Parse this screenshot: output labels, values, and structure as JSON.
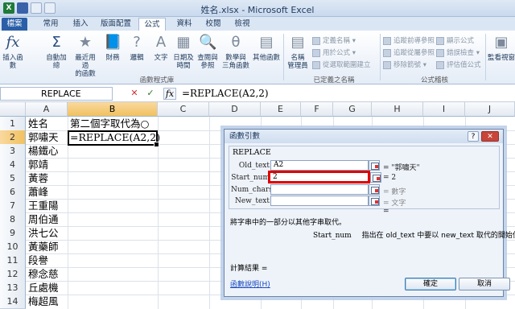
{
  "window": {
    "title": "姓名.xlsx - Microsoft Excel"
  },
  "tabs": [
    "檔案",
    "常用",
    "插入",
    "版面配置",
    "公式",
    "資料",
    "校閱",
    "檢視"
  ],
  "ribbon": {
    "buttons": [
      {
        "label1": "插入函數",
        "label2": "",
        "icon": "fx"
      },
      {
        "label1": "自動加總",
        "label2": "",
        "icon": "Σ"
      },
      {
        "label1": "最近用過",
        "label2": "的函數",
        "icon": "★"
      },
      {
        "label1": "財務",
        "label2": "",
        "icon": "📘"
      },
      {
        "label1": "邏輯",
        "label2": "",
        "icon": "?"
      },
      {
        "label1": "文字",
        "label2": "",
        "icon": "A"
      },
      {
        "label1": "日期及",
        "label2": "時間",
        "icon": "▦"
      },
      {
        "label1": "查閱與",
        "label2": "參照",
        "icon": "🔍"
      },
      {
        "label1": "數學與",
        "label2": "三角函數",
        "icon": "θ"
      },
      {
        "label1": "其他函數",
        "label2": "",
        "icon": "▤"
      },
      {
        "label1": "名稱",
        "label2": "管理員",
        "icon": "▤"
      },
      {
        "label1": "監看視窗",
        "label2": "",
        "icon": "▣"
      }
    ],
    "small": [
      "定義名稱 ▾",
      "用於公式 ▾",
      "從選取範圍建立",
      "追蹤前導參照",
      "追蹤從屬參照",
      "移除箭號 ▾",
      "顯示公式",
      "錯誤檢查 ▾",
      "評估值公式"
    ],
    "groups": [
      "函數程式庫",
      "已定義之名稱",
      "公式稽核"
    ]
  },
  "formula_bar": {
    "name_box": "REPLACE",
    "cancel": "✕",
    "enter": "✓",
    "fx": "fx",
    "formula": "=REPLACE(A2,2)"
  },
  "columns": [
    "A",
    "B",
    "C",
    "D",
    "E",
    "F",
    "G",
    "H",
    "I",
    "J"
  ],
  "rows": [
    "1",
    "2",
    "3",
    "4",
    "5",
    "6",
    "7",
    "8",
    "9",
    "10",
    "11",
    "12",
    "13",
    "14"
  ],
  "cells": {
    "A": [
      "姓名",
      "郭嘯天",
      "楊鐵心",
      "郭靖",
      "黃蓉",
      "蕭峰",
      "王重陽",
      "周伯通",
      "洪七公",
      "黃藥師",
      "段譽",
      "穆念慈",
      "丘處機",
      "梅超風"
    ],
    "B1": "第二個字取代為○",
    "B2": "=REPLACE(A2,2)"
  },
  "dialog": {
    "title": "函數引數",
    "help": "?",
    "close": "✕",
    "function": "REPLACE",
    "args": [
      {
        "name": "Old_text",
        "value": "A2",
        "result": "= \"郭嘯天\""
      },
      {
        "name": "Start_num",
        "value": "2",
        "result": "= 2"
      },
      {
        "name": "Num_chars",
        "value": "",
        "result": "= 數字"
      },
      {
        "name": "New_text",
        "value": "",
        "result": "= 文字"
      }
    ],
    "total": "=",
    "description": "將字串中的一部分以其他字串取代。",
    "arg_desc_name": "Start_num",
    "arg_desc_text": "指出在 old_text 中要以 new_text 取代的開始位置。",
    "result": "計算結果 =",
    "help_link": "函數說明(H)",
    "ok": "確定",
    "cancel": "取消"
  }
}
